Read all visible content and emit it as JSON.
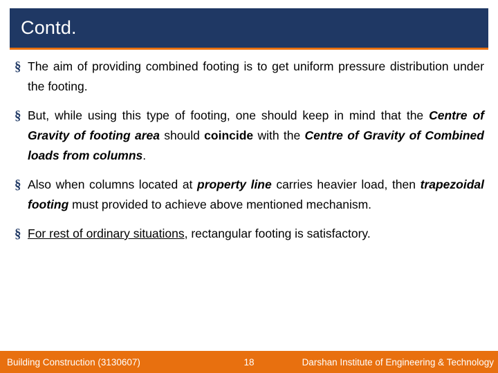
{
  "slide": {
    "title": "Contd.",
    "title_bg": "#1f3864",
    "accent": "#e8700f",
    "bullet_glyph": "§",
    "bullets": [
      {
        "id": "bullet-1",
        "plain": "The aim of providing combined footing is to get uniform pressure distribution under the footing."
      },
      {
        "id": "bullet-2",
        "plain": "But, while using this type of footing, one should keep in mind that the Centre of Gravity of footing area should coincide with the Centre of Gravity of Combined loads from columns."
      },
      {
        "id": "bullet-3",
        "plain": "Also when columns located at property line carries heavier load, then trapezoidal footing must provided to achieve above mentioned mechanism."
      },
      {
        "id": "bullet-4",
        "plain": "For rest of ordinary situations, rectangular footing is satisfactory."
      }
    ],
    "bullet_1_parts": {
      "t1": "The aim of providing combined footing is to get uniform pressure distribution under the footing."
    },
    "bullet_2_parts": {
      "t1": "But, while using this type of footing, one should keep in mind that the ",
      "b1": "Centre of Gravity of footing area",
      "t2": " should ",
      "b2": "coincide",
      "t3": " with the ",
      "b3": "Centre of Gravity of Combined loads from columns",
      "t4": "."
    },
    "bullet_3_parts": {
      "t1": "Also when columns located at ",
      "b1": "property line",
      "t2": " carries heavier load, then ",
      "b2": "trapezoidal footing",
      "t3": " must provided to achieve above mentioned mechanism."
    },
    "bullet_4_parts": {
      "u1": "For rest of ordinary situations",
      "t1": ", rectangular footing is satisfactory."
    }
  },
  "footer": {
    "left": "Building Construction (3130607)",
    "page": "18",
    "right": "Darshan Institute of Engineering & Technology"
  }
}
